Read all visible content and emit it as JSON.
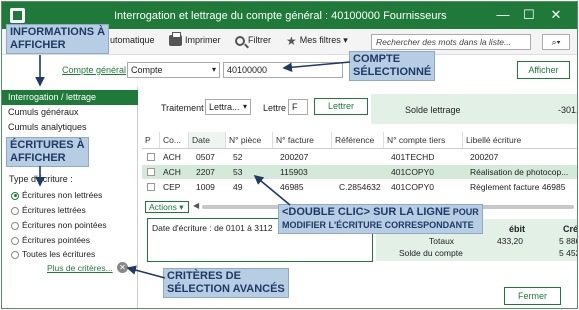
{
  "window": {
    "title": "Interrogation et lettrage du compte général : 40100000 Fournisseurs",
    "controls": [
      "—",
      "☐",
      "✕"
    ]
  },
  "toolbar": {
    "auto_label": "utomatique",
    "print_label": "Imprimer",
    "filter_label": "Filtrer",
    "favorites_label": "Mes filtres",
    "search_placeholder": "Rechercher des mots dans la liste...",
    "search_go_icon": "search-icon"
  },
  "account_select": {
    "label": "Compte général",
    "type_value": "Compte",
    "account_value": "40100000",
    "show_button": "Afficher"
  },
  "sidebar": {
    "items": [
      {
        "label": "Interrogation / lettrage",
        "active": true
      },
      {
        "label": "Cumuls généraux",
        "active": false
      },
      {
        "label": "Cumuls analytiques",
        "active": false
      }
    ],
    "entry_type_label": "Type d'écriture :",
    "entry_types": [
      {
        "label": "Écritures non lettrées",
        "selected": true
      },
      {
        "label": "Écritures lettrées",
        "selected": false
      },
      {
        "label": "Écritures non pointées",
        "selected": false
      },
      {
        "label": "Écritures pointées",
        "selected": false
      },
      {
        "label": "Toutes les écritures",
        "selected": false
      }
    ],
    "more_criteria": "Plus de critères..."
  },
  "filter": {
    "treatment_label": "Traitement",
    "treatment_value": "Lettra...",
    "letter_label": "Lettre",
    "letter_value": "F",
    "letter_button": "Lettrer",
    "balance_label": "Solde lettrage",
    "balance_value": "-301,"
  },
  "table": {
    "columns": [
      "P",
      "Co...",
      "Date",
      "N° pièce",
      "N° facture",
      "Référence",
      "N° compte tiers",
      "Libellé écriture"
    ],
    "rows": [
      {
        "co": "ACH",
        "date": "0507",
        "piece": "52",
        "facture": "200207",
        "reference": "",
        "tiers": "401TECHD",
        "libelle": "200207",
        "selected": false
      },
      {
        "co": "ACH",
        "date": "2207",
        "piece": "53",
        "facture": "115903",
        "reference": "",
        "tiers": "401COPY0",
        "libelle": "Réalisation de photocop...",
        "selected": true
      },
      {
        "co": "CEP",
        "date": "1009",
        "piece": "49",
        "facture": "46985",
        "reference": "C.2854632",
        "tiers": "401COPY0",
        "libelle": "Règlement facture 46985",
        "selected": false
      }
    ]
  },
  "details": {
    "actions_label": "Actions",
    "entry_date_text": "Date d'écriture : de 0101 à 3112",
    "debit_header": "ébit",
    "credit_header": "Cré",
    "totals_label": "Totaux",
    "totals_debit": "433,20",
    "totals_credit": "5 886,",
    "balance_label": "Solde du compte",
    "balance_credit": "5 452"
  },
  "close_button": "Fermer",
  "annotations": {
    "info_display": [
      "INFORMATIONS À",
      "AFFICHER"
    ],
    "selected_account": [
      "COMPTE",
      "SÉLECTIONNÉ"
    ],
    "entries_display": [
      "ÉCRITURES À",
      "AFFICHER"
    ],
    "double_click_main": "<DOUBLE CLIC> SUR LA LIGNE",
    "double_click_small1": " POUR",
    "double_click_line2": "MODIFIER L'ÉCRITURE CORRESPONDANTE",
    "advanced_criteria": [
      "CRITÈRES DE",
      "SÉLECTION AVANCÉS"
    ]
  },
  "colors": {
    "brand_green": "#1f7a3a",
    "selection_green": "#d4e9da",
    "panel_green": "#e2f0e6",
    "callout_blue": "#b7cde3",
    "callout_text": "#1f3a66"
  }
}
